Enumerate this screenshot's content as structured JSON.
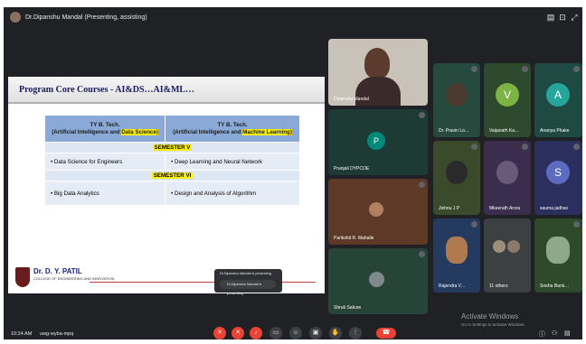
{
  "topbar": {
    "presenter_title": "Dr.Dipanshu Mandal (Presenting, assisting)"
  },
  "slide": {
    "title": "Program Core Courses - AI&DS…AI&ML…",
    "col1_prefix": "TY B. Tech.",
    "col1_part1": "(Artificial Intelligence and ",
    "col1_hl": "Data Science)",
    "col2_prefix": "TY B. Tech.",
    "col2_part1": "(Artificial Intelligence and ",
    "col2_hl": "Machine Learning)",
    "semester5": "SEMESTER V",
    "sem5_left": "Data Science for Engineers",
    "sem5_right": "Deep Learning and Neural Network",
    "semester6": "SEMESTER VI",
    "sem6_left": "Big Data Analytics",
    "sem6_right": "Design and Analysis of Algorithm",
    "college_name": "Dr. D. Y. PATIL",
    "college_sub": "COLLEGE OF ENGINEERING AND INNOVATION"
  },
  "tiles": {
    "presenter_name": "Dipanshu Mandal",
    "pranjali": "Pranjali DYPCOE",
    "pranjali_letter": "P",
    "parikshit": "Parikshit R. Mahalle",
    "shruti": "Shruti Sakure",
    "pravin": "Dr. Pravin Lo…",
    "vaijanath": "Vaijanath Ka…",
    "vaijanath_letter": "V",
    "ananya": "Ananya Phake",
    "ananya_letter": "A",
    "jishnu": "Jishnu J P",
    "mkeerath": "Mkeerath Arora",
    "sauma": "sauma jadhav",
    "sauma_letter": "S",
    "rajendra": "Rajendra V…",
    "others": "11 others",
    "sneha": "Sneha Bank…"
  },
  "bottombar": {
    "time": "10:24 AM",
    "meeting_code": "uwg-wyba-mpq",
    "activate_title": "Activate Windows",
    "activate_sub": "Go to Settings to activate Windows."
  },
  "share_popup": {
    "line1": "Dr.Dipanshu Mandal is presenting",
    "button": "Dr.Dipanshu Mandal is presenting"
  },
  "colors": {
    "screen_bg": "#202124",
    "table_header": "#8aa9d6",
    "highlight": "#fff200",
    "end_call": "#ea4335"
  }
}
